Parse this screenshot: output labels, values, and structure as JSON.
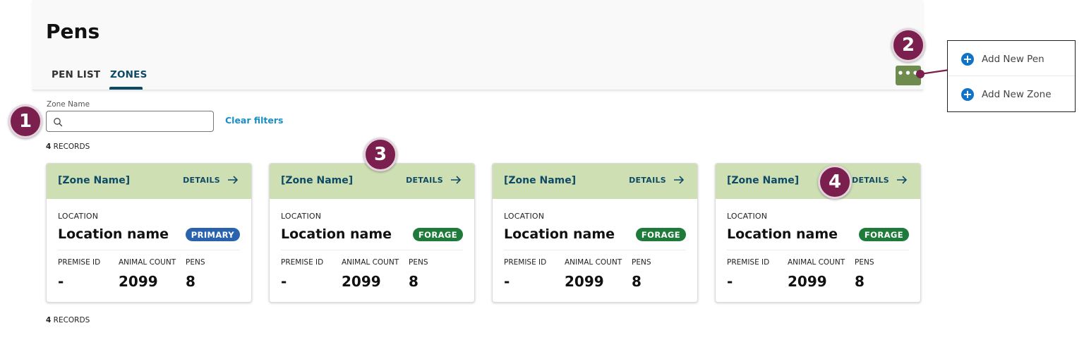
{
  "page": {
    "title": "Pens"
  },
  "tabs": [
    {
      "label": "PEN LIST",
      "active": false
    },
    {
      "label": "ZONES",
      "active": true
    }
  ],
  "more_button": {
    "label": "•••",
    "icon": "more-horizontal-icon",
    "color": "#6e8c4d"
  },
  "menu": {
    "items": [
      {
        "label": "Add New Pen",
        "icon": "plus-circle-icon"
      },
      {
        "label": "Add New Zone",
        "icon": "plus-circle-icon"
      }
    ]
  },
  "filters": {
    "zone_name_label": "Zone Name",
    "zone_name_value": "",
    "clear_label": "Clear filters"
  },
  "records": {
    "count": "4",
    "label": "RECORDS"
  },
  "card_labels": {
    "details": "DETAILS",
    "location": "LOCATION",
    "premise_id": "PREMISE ID",
    "animal_count": "ANIMAL COUNT",
    "pens": "PENS"
  },
  "cards": [
    {
      "zone_name": "[Zone Name]",
      "location_name": "Location name",
      "badge": "PRIMARY",
      "badge_color": "#2a63ad",
      "premise_id": "-",
      "animal_count": "2099",
      "pens": "8"
    },
    {
      "zone_name": "[Zone Name]",
      "location_name": "Location name",
      "badge": "FORAGE",
      "badge_color": "#1e7b3a",
      "premise_id": "-",
      "animal_count": "2099",
      "pens": "8"
    },
    {
      "zone_name": "[Zone Name]",
      "location_name": "Location name",
      "badge": "FORAGE",
      "badge_color": "#1e7b3a",
      "premise_id": "-",
      "animal_count": "2099",
      "pens": "8"
    },
    {
      "zone_name": "[Zone Name]",
      "location_name": "Location name",
      "badge": "FORAGE",
      "badge_color": "#1e7b3a",
      "premise_id": "-",
      "animal_count": "2099",
      "pens": "8"
    }
  ],
  "annotations": [
    "1",
    "2",
    "3",
    "4"
  ],
  "colors": {
    "accent": "#0e4a66",
    "link": "#1a8fc6",
    "card_header": "#cfdfb4",
    "annotation": "#7a1f4e"
  }
}
